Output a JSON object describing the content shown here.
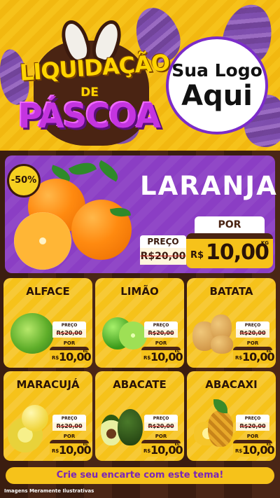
{
  "header": {
    "title_line1": "LIQUIDAÇÃO",
    "title_line2": "DE",
    "title_line3": "PÁSCOA",
    "logo_line1": "Sua Logo",
    "logo_line2": "Aqui"
  },
  "hero": {
    "discount_badge": "-50%",
    "product_name": "LARANJA",
    "por_label": "POR",
    "preco_label": "PREÇO",
    "old_price": "R$20,00",
    "currency": "R$",
    "new_price": "10,00",
    "unit": "KG"
  },
  "products": [
    {
      "name": "ALFACE",
      "preco_label": "PREÇO",
      "old_price": "R$20,00",
      "por_label": "POR",
      "currency": "R$",
      "price": "10,00",
      "unit": "KG"
    },
    {
      "name": "LIMÃO",
      "preco_label": "PREÇO",
      "old_price": "R$20,00",
      "por_label": "POR",
      "currency": "R$",
      "price": "10,00",
      "unit": "KG"
    },
    {
      "name": "BATATA",
      "preco_label": "PREÇO",
      "old_price": "R$20,00",
      "por_label": "POR",
      "currency": "R$",
      "price": "10,00",
      "unit": "KG"
    },
    {
      "name": "MARACUJÁ",
      "preco_label": "PREÇO",
      "old_price": "R$20,00",
      "por_label": "POR",
      "currency": "R$",
      "price": "10,00",
      "unit": "KG"
    },
    {
      "name": "ABACATE",
      "preco_label": "PREÇO",
      "old_price": "R$20,00",
      "por_label": "POR",
      "currency": "R$",
      "price": "10,00",
      "unit": "KG"
    },
    {
      "name": "ABACAXI",
      "preco_label": "PREÇO",
      "old_price": "R$20,00",
      "por_label": "POR",
      "currency": "R$",
      "price": "10,00",
      "unit": "KG"
    }
  ],
  "footer": {
    "cta": "Crie seu encarte com este tema!",
    "disclaimer": "Imagens Meramente Ilustrativas"
  },
  "colors": {
    "yellow": "#f6c21a",
    "purple": "#8b3ec4",
    "chocolate": "#4a2413"
  }
}
